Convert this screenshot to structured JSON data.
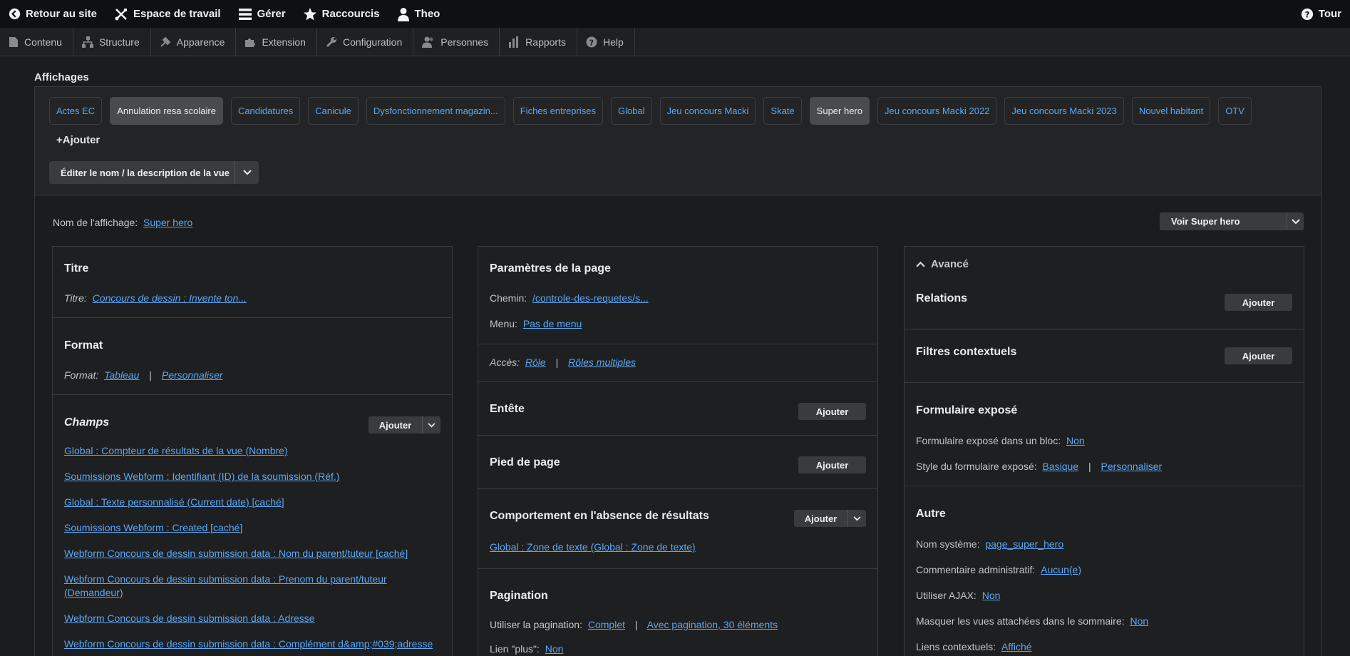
{
  "toolbar": {
    "back": "Retour au site",
    "workspace": "Espace de travail",
    "manage": "Gérer",
    "shortcuts": "Raccourcis",
    "user": "Theo",
    "tour": "Tour"
  },
  "tray": [
    "Contenu",
    "Structure",
    "Apparence",
    "Extension",
    "Configuration",
    "Personnes",
    "Rapports",
    "Help"
  ],
  "displays": {
    "heading": "Affichages",
    "tabs": [
      "Actes EC",
      "Annulation resa scolaire",
      "Candidatures",
      "Canicule",
      "Dysfonctionnement magazin...",
      "Fiches entreprises",
      "Global",
      "Jeu concours Macki",
      "Skate",
      "Super hero",
      "Jeu concours Macki 2022",
      "Jeu concours Macki 2023",
      "Nouvel habitant",
      "OTV"
    ],
    "add": "Ajouter",
    "edit_button": "Éditer le nom / la description de la vue"
  },
  "main": {
    "display_name_label": "Nom de l'affichage:",
    "display_name_value": "Super hero",
    "view_button": "Voir Super hero"
  },
  "col1": {
    "title_heading": "Titre",
    "title_label": "Titre:",
    "title_value": "Concours de dessin : Invente ton...",
    "format_heading": "Format",
    "format_label": "Format:",
    "format_value": "Tableau",
    "format_custom": "Personnaliser",
    "fields_heading": "Champs",
    "fields_add": "Ajouter",
    "fields": [
      "Global : Compteur de résultats de la vue (Nombre)",
      "Soumissions Webform : Identifiant (ID) de la soumission (Réf.)",
      "Global : Texte personnalisé (Current date) [caché]",
      "Soumissions Webform : Created [caché]",
      "Webform Concours de dessin submission data : Nom du parent/tuteur [caché]",
      "Webform Concours de dessin submission data : Prenom du parent/tuteur (Demandeur)",
      "Webform Concours de dessin submission data : Adresse",
      "Webform Concours de dessin submission data : Complément d&amp;#039;adresse"
    ]
  },
  "col2": {
    "page_heading": "Paramètres de la page",
    "path_label": "Chemin:",
    "path_value": "/controle-des-requetes/s...",
    "menu_label": "Menu:",
    "menu_value": "Pas de menu",
    "access_label": "Accès:",
    "access_value": "Rôle",
    "access_multi": "Rôles multiples",
    "header_heading": "Entête",
    "footer_heading": "Pied de page",
    "empty_heading": "Comportement en l'absence de résultats",
    "empty_value": "Global : Zone de texte (Global : Zone de texte)",
    "pager_heading": "Pagination",
    "pager_label": "Utiliser la pagination:",
    "pager_value": "Complet",
    "pager_detail": "Avec pagination, 30 éléments",
    "more_label": "Lien \"plus\":",
    "more_value": "Non",
    "add": "Ajouter"
  },
  "col3": {
    "advanced": "Avancé",
    "relations": "Relations",
    "contextual": "Filtres contextuels",
    "exposed_heading": "Formulaire exposé",
    "exposed_block_label": "Formulaire exposé dans un bloc:",
    "exposed_block_value": "Non",
    "exposed_style_label": "Style du formulaire exposé:",
    "exposed_style_value": "Basique",
    "exposed_style_custom": "Personnaliser",
    "other_heading": "Autre",
    "machine_label": "Nom système:",
    "machine_value": "page_super_hero",
    "comment_label": "Commentaire administratif:",
    "comment_value": "Aucun(e)",
    "ajax_label": "Utiliser AJAX:",
    "ajax_value": "Non",
    "hide_label": "Masquer les vues attachées dans le sommaire:",
    "hide_value": "Non",
    "ctx_label": "Liens contextuels:",
    "ctx_value": "Affiché",
    "add": "Ajouter"
  }
}
